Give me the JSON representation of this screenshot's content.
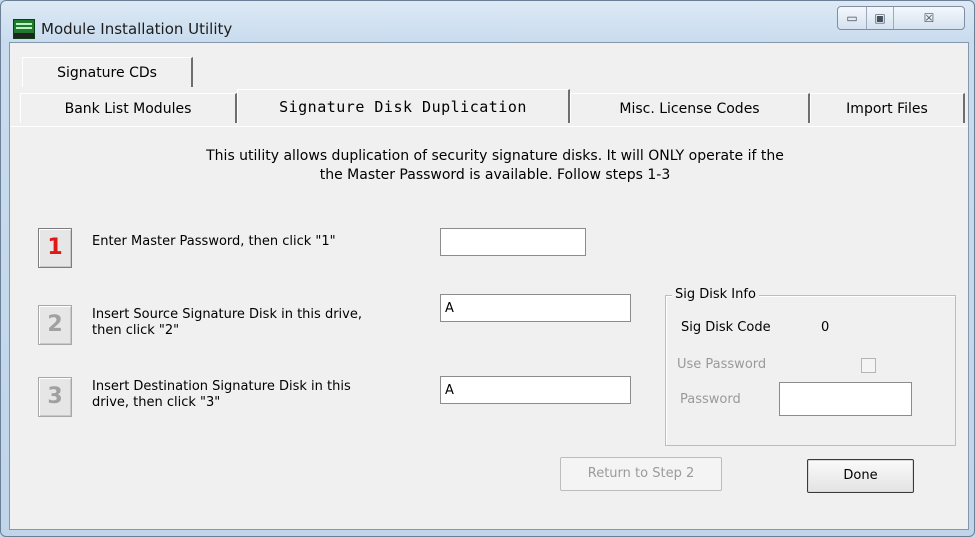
{
  "window": {
    "title": "Module Installation Utility",
    "caption": {
      "minimize": "▭",
      "maximize": "▣",
      "close": "☒"
    }
  },
  "tabs": {
    "row1": [
      "Signature CDs"
    ],
    "row2": [
      "Bank List Modules",
      "Signature Disk Duplication",
      "Misc. License Codes",
      "Import Files"
    ],
    "active": "Signature Disk Duplication"
  },
  "description": {
    "line1": "This utility allows duplication of security signature disks. It will ONLY operate if the",
    "line2": "the Master Password is available. Follow steps 1-3"
  },
  "steps": [
    {
      "number": "1",
      "label": "Enter Master Password, then click \"1\"",
      "value": "",
      "enabled": true
    },
    {
      "number": "2",
      "label_line1": "Insert Source Signature Disk in this drive,",
      "label_line2": "then click \"2\"",
      "value": "A",
      "enabled": false
    },
    {
      "number": "3",
      "label_line1": "Insert Destination Signature Disk in this",
      "label_line2": "drive, then click \"3\"",
      "value": "A",
      "enabled": false
    }
  ],
  "sig_disk_info": {
    "title": "Sig Disk Info",
    "code_label": "Sig Disk Code",
    "code_value": "0",
    "use_password_label": "Use Password",
    "use_password_checked": false,
    "password_label": "Password",
    "password_value": ""
  },
  "buttons": {
    "return": "Return to Step 2",
    "done": "Done"
  },
  "colors": {
    "active_step": "#e01818",
    "disabled_text": "#9b9b9b"
  }
}
